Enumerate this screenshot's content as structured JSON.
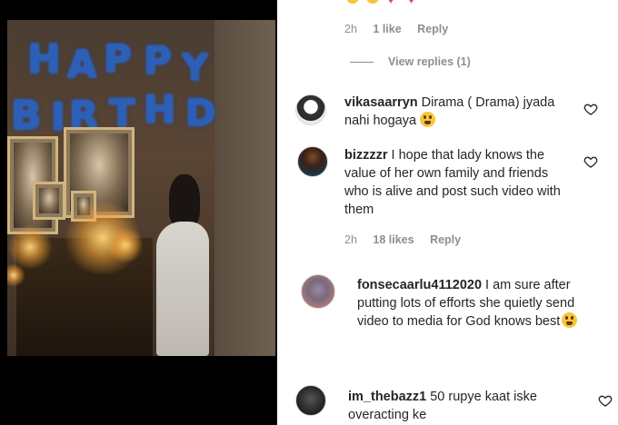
{
  "comments": [
    {
      "meta": {
        "time": "2h",
        "likes": "1 like",
        "reply": "Reply"
      },
      "view_replies": "View replies (1)"
    },
    {
      "username": "vikasaarryn",
      "text": "Dirama ( Drama) jyada nahi hogaya",
      "emoji": "weary-face"
    },
    {
      "username": "bizzzzr",
      "text": "I hope that lady knows the value of her own family and friends who is alive and post such video with them",
      "meta": {
        "time": "2h",
        "likes": "18 likes",
        "reply": "Reply"
      }
    },
    {
      "username": "fonsecaarlu4112020",
      "text": "I am sure after putting lots of efforts she quietly send video to media for God knows best",
      "emoji": "hushed-face"
    },
    {
      "username": "im_thebazz1",
      "text": "50 rupye kaat iske overacting ke"
    }
  ],
  "colors": {
    "meta": "#8e8e8e",
    "text": "#262626",
    "banner": "#2c5fb8"
  }
}
